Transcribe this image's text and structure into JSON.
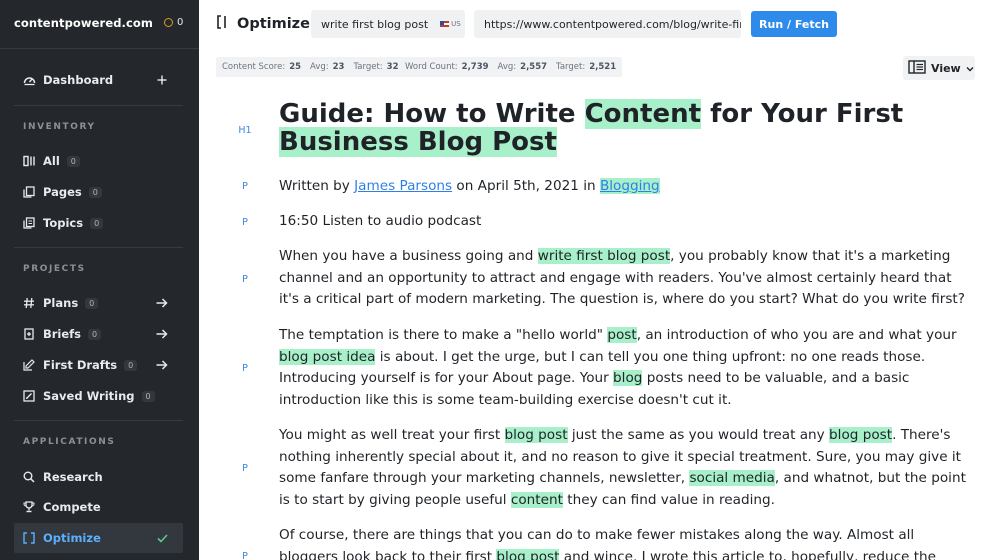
{
  "sidebar": {
    "brand": "contentpowered.com",
    "credits": "0",
    "dashboard": "Dashboard",
    "inventory_label": "INVENTORY",
    "inventory": [
      {
        "label": "All",
        "count": "0"
      },
      {
        "label": "Pages",
        "count": "0"
      },
      {
        "label": "Topics",
        "count": "0"
      }
    ],
    "projects_label": "PROJECTS",
    "projects": [
      {
        "label": "Plans",
        "count": "0"
      },
      {
        "label": "Briefs",
        "count": "0"
      },
      {
        "label": "First Drafts",
        "count": "0"
      },
      {
        "label": "Saved Writing",
        "count": "0"
      }
    ],
    "applications_label": "APPLICATIONS",
    "applications": [
      {
        "label": "Research"
      },
      {
        "label": "Compete"
      },
      {
        "label": "Optimize"
      }
    ]
  },
  "topbar": {
    "title": "Optimize",
    "keyword": "write first blog post",
    "locale": "US",
    "url": "https://www.contentpowered.com/blog/write-first-business-blog-post/",
    "run_label": "Run / Fetch"
  },
  "scores": {
    "content_score_label": "Content Score:",
    "content_score": "25",
    "content_avg_label": "Avg:",
    "content_avg": "23",
    "content_target_label": "Target:",
    "content_target": "32",
    "word_count_label": "Word Count:",
    "word_count": "2,739",
    "word_avg_label": "Avg:",
    "word_avg": "2,557",
    "word_target_label": "Target:",
    "word_target": "2,521"
  },
  "view_label": "View",
  "content": {
    "tags": {
      "h1": "H1",
      "p": "P"
    },
    "heading": [
      {
        "t": "Guide: How to Write "
      },
      {
        "t": "Content",
        "h": true
      },
      {
        "t": " for Your First "
      },
      {
        "t": "Business Blog Post",
        "h": true
      }
    ],
    "byline": [
      {
        "t": "Written by "
      },
      {
        "t": "James Parsons",
        "link": true
      },
      {
        "t": " on April 5th, 2021 in "
      },
      {
        "t": "Blogging",
        "link": true,
        "h": true
      }
    ],
    "audio": "16:50 Listen to audio podcast",
    "p1": [
      {
        "t": "When you have a business going and "
      },
      {
        "t": "write first blog post",
        "h": true
      },
      {
        "t": ", you probably know that it's a marketing channel and an opportunity to attract and engage with readers. You've almost certainly heard that it's a critical part of modern marketing. The question is, where do you start? What do you write first?"
      }
    ],
    "p2": [
      {
        "t": "The temptation is there to make a \"hello world\" "
      },
      {
        "t": "post",
        "h": true
      },
      {
        "t": ", an introduction of who you are and what your "
      },
      {
        "t": "blog post idea",
        "h": true
      },
      {
        "t": " is about. I get the urge, but I can tell you one thing upfront: no one reads those. Introducing yourself is for your About page. Your "
      },
      {
        "t": "blog",
        "h": true
      },
      {
        "t": " posts need to be valuable, and a basic introduction like this is some team-building exercise doesn't cut it."
      }
    ],
    "p3": [
      {
        "t": "You might as well treat your first "
      },
      {
        "t": "blog post",
        "h": true
      },
      {
        "t": " just the same as you would treat any "
      },
      {
        "t": "blog post",
        "h": true
      },
      {
        "t": ". There's nothing inherently special about it, and no reason to give it special treatment. Sure, you may give it some fanfare through your marketing channels, newsletter, "
      },
      {
        "t": "social media",
        "h": true
      },
      {
        "t": ", and whatnot, but the point is to start by giving people useful "
      },
      {
        "t": "content",
        "h": true
      },
      {
        "t": " they can find value in reading."
      }
    ],
    "p4": [
      {
        "t": "Of course, there are things that you can do to make fewer mistakes along the way. Almost all bloggers look back to their first "
      },
      {
        "t": "blog post",
        "h": true
      },
      {
        "t": " and wince. I wrote this article to, hopefully, reduce the"
      }
    ]
  }
}
